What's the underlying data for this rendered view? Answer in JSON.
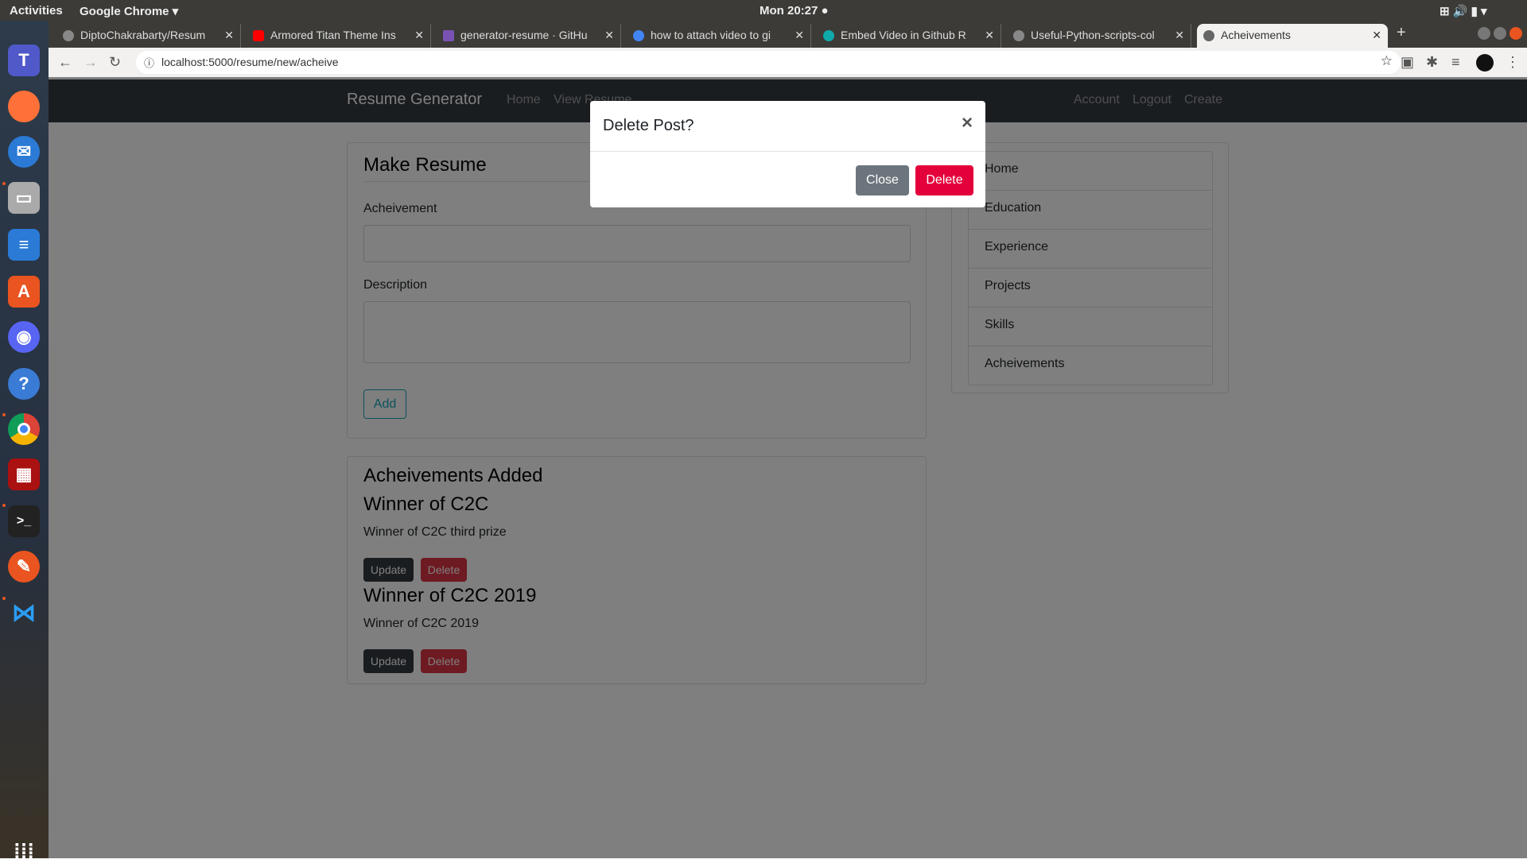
{
  "system": {
    "activities": "Activities",
    "app": "Google Chrome ▾",
    "clock": "Mon 20:27 ●"
  },
  "dock": [
    "teams",
    "firefox",
    "thunderbird",
    "files",
    "writer",
    "software",
    "discord",
    "help",
    "chrome",
    "app",
    "terminal",
    "pen",
    "vscode"
  ],
  "tabs": [
    {
      "title": "DiptoChakrabarty/Resum",
      "fav": "#888"
    },
    {
      "title": "Armored Titan Theme Ins",
      "fav": "#f00"
    },
    {
      "title": "generator-resume · GitHu",
      "fav": "#7952b3"
    },
    {
      "title": "how to attach video to gi",
      "fav": "#4285f4"
    },
    {
      "title": "Embed Video in Github R",
      "fav": "#1aa"
    },
    {
      "title": "Useful-Python-scripts-col",
      "fav": "#888"
    },
    {
      "title": "Acheivements",
      "fav": "#666"
    }
  ],
  "url": "localhost:5000/resume/new/acheive",
  "navbar": {
    "brand": "Resume Generator",
    "home": "Home",
    "view": "View Resume",
    "account": "Account",
    "logout": "Logout",
    "create": "Create"
  },
  "form": {
    "title": "Make Resume",
    "achievement_label": "Acheivement",
    "achievement_value": "",
    "description_label": "Description",
    "description_value": "",
    "add": "Add"
  },
  "sidebar": [
    "Home",
    "Education",
    "Experience",
    "Projects",
    "Skills",
    "Acheivements"
  ],
  "added": {
    "title": "Acheivements Added",
    "items": [
      {
        "title": "Winner of C2C",
        "desc": "Winner of C2C third prize"
      },
      {
        "title": "Winner of C2C 2019",
        "desc": "Winner of C2C 2019"
      }
    ],
    "update": "Update",
    "delete": "Delete"
  },
  "modal": {
    "title": "Delete Post?",
    "close_x": "×",
    "close": "Close",
    "delete": "Delete"
  },
  "colors": {
    "danger": "#dc3545",
    "modal_delete": "#e4003b",
    "secondary": "#6c757d",
    "dark": "#343a40"
  }
}
